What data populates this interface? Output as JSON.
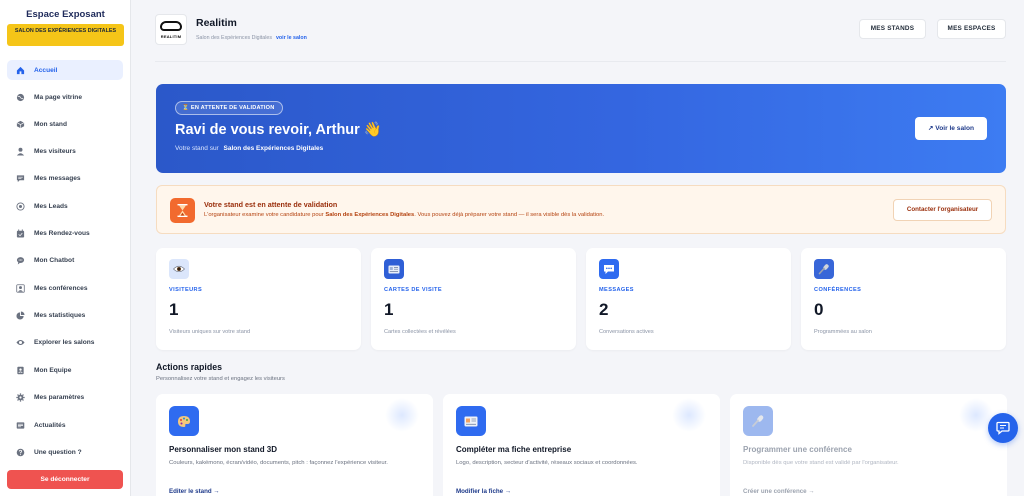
{
  "sidebar": {
    "title": "Espace Exposant",
    "salon_label": "SALON DES EXPÉRIENCES DIGITALES",
    "items": [
      {
        "label": "Accueil",
        "icon": "home-icon",
        "active": true
      },
      {
        "label": "Ma page vitrine",
        "icon": "globe-icon"
      },
      {
        "label": "Mon stand",
        "icon": "cube-icon"
      },
      {
        "label": "Mes visiteurs",
        "icon": "user-icon"
      },
      {
        "label": "Mes messages",
        "icon": "message-icon"
      },
      {
        "label": "Mes Leads",
        "icon": "target-icon"
      },
      {
        "label": "Mes Rendez-vous",
        "icon": "calendar-icon"
      },
      {
        "label": "Mon Chatbot",
        "icon": "chatbot-icon"
      },
      {
        "label": "Mes conférences",
        "icon": "speaker-icon"
      },
      {
        "label": "Mes statistiques",
        "icon": "pie-chart-icon"
      },
      {
        "label": "Explorer les salons",
        "icon": "eye-icon"
      },
      {
        "label": "Mon Equipe",
        "icon": "team-icon"
      },
      {
        "label": "Mes paramètres",
        "icon": "gear-icon"
      },
      {
        "label": "Actualités",
        "icon": "news-icon"
      },
      {
        "label": "Une question ?",
        "icon": "help-icon"
      }
    ],
    "logout_label": "Se déconnecter"
  },
  "header": {
    "logo_text": "REALITIM",
    "company_name": "Realitim",
    "salon_name": "Salon des Expériences Digitales",
    "view_salon_link": "voir le salon",
    "btn_stands": "MES STANDS",
    "btn_spaces": "MES ESPACES"
  },
  "hero": {
    "badge": "⏳ EN ATTENTE DE VALIDATION",
    "title": "Ravi de vous revoir, Arthur 👋",
    "subtitle_prefix": "Votre stand sur",
    "subtitle_salon": "Salon des Expériences Digitales",
    "button": "↗ Voir le salon"
  },
  "alert": {
    "title": "Votre stand est en attente de validation",
    "text_prefix": "L'organisateur examine votre candidature pour",
    "text_salon": "Salon des Expériences Digitales",
    "text_suffix": ". Vous pouvez déjà préparer votre stand — il sera visible dès la validation.",
    "button": "Contacter l'organisateur"
  },
  "stats": [
    {
      "label": "VISITEURS",
      "value": "1",
      "desc": "Visiteurs uniques sur votre stand",
      "icon": "eye-icon"
    },
    {
      "label": "CARTES DE VISITE",
      "value": "1",
      "desc": "Cartes collectées et révélées",
      "icon": "card-icon"
    },
    {
      "label": "MESSAGES",
      "value": "2",
      "desc": "Conversations actives",
      "icon": "chat-icon"
    },
    {
      "label": "CONFÉRENCES",
      "value": "0",
      "desc": "Programmées au salon",
      "icon": "microphone-icon"
    }
  ],
  "quick_actions": {
    "title": "Actions rapides",
    "subtitle": "Personnalisez votre stand et engagez les visiteurs",
    "cards": [
      {
        "name": "Personnaliser mon stand 3D",
        "desc": "Couleurs, kakémono, écran/vidéo, documents, pitch : façonnez l'expérience visiteur.",
        "link": "Editer le stand →",
        "icon": "palette-icon"
      },
      {
        "name": "Compléter ma fiche entreprise",
        "desc": "Logo, description, secteur d'activité, réseaux sociaux et coordonnées.",
        "link": "Modifier la fiche →",
        "icon": "id-card-icon"
      },
      {
        "name": "Programmer une conférence",
        "desc": "Disponible dès que votre stand est validé par l'organisateur.",
        "link": "Créer une conférence →",
        "icon": "microphone-icon"
      }
    ]
  },
  "colors": {
    "primary": "#2563eb",
    "warning": "#f26a2e",
    "logout": "#ef5350",
    "salon_badge": "#f5c518"
  }
}
